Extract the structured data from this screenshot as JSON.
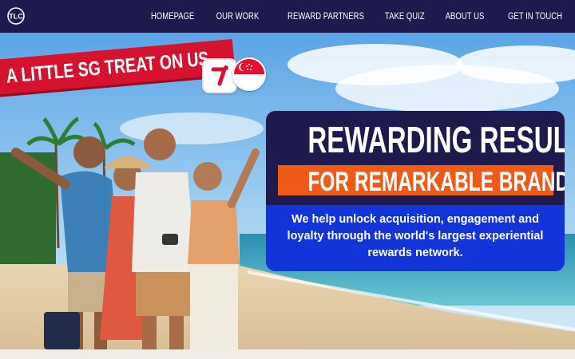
{
  "nav": {
    "items": [
      "HOMEPAGE",
      "OUR WORK",
      "REWARD PARTNERS",
      "TAKE QUIZ",
      "ABOUT US",
      "GET IN TOUCH"
    ]
  },
  "promo": {
    "ribbon_text": "A LITTLE SG TREAT ON US"
  },
  "hero": {
    "headline": "REWARDING RESULTS",
    "subheadline": "FOR REMARKABLE BRANDS",
    "description": "We help unlock acquisition, engagement and loyalty through the world's largest experiential rewards network."
  },
  "colors": {
    "navy": "#1e1a4d",
    "orange": "#ee5a17",
    "blue": "#1234d9",
    "red": "#d5132f"
  }
}
